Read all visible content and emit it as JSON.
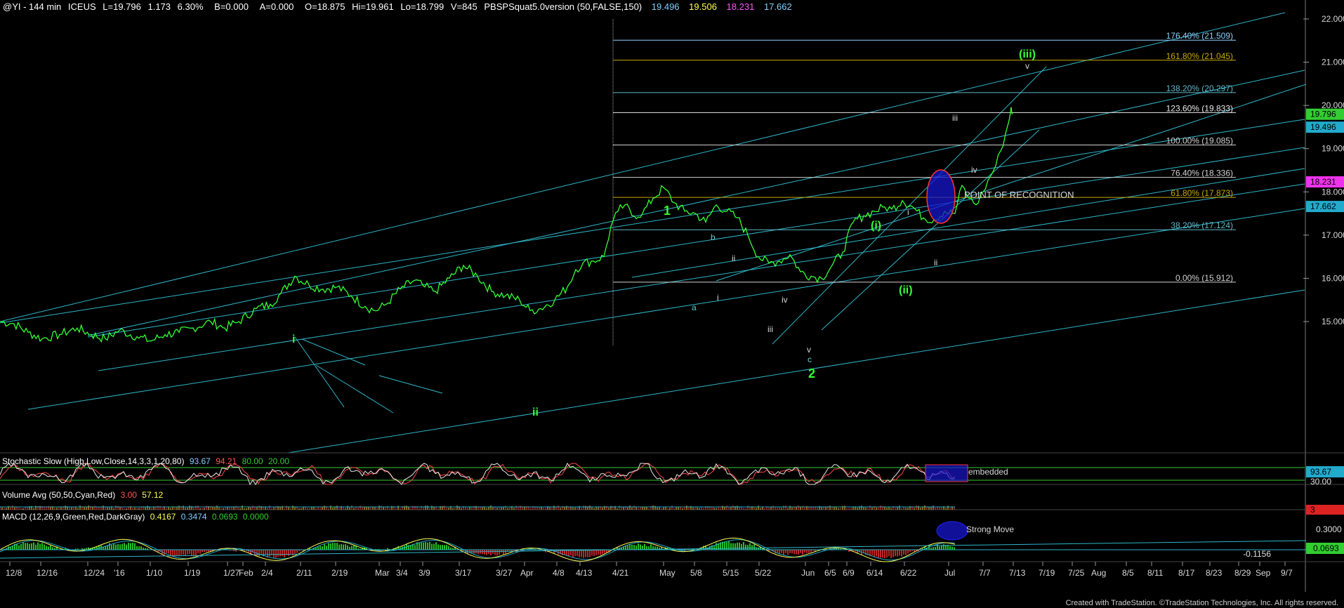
{
  "header": {
    "symbol": "@YI - 144 min",
    "exchange": "ICEUS",
    "last": "L=19.796",
    "change": "1.173",
    "pct": "6.30%",
    "bid": "B=0.000",
    "ask": "A=0.000",
    "open": "O=18.875",
    "high": "Hi=19.961",
    "low": "Lo=18.799",
    "volume": "V=845",
    "indicator": "PBSPSquat5.0version (50,FALSE,150)",
    "ind_values": [
      "19.496",
      "19.506",
      "18.231",
      "17.662"
    ],
    "ind_colors": [
      "#7fd0ff",
      "#ffff55",
      "#ff55ff",
      "#7fd0ff"
    ]
  },
  "chart_data": {
    "type": "line",
    "title": "@YI - 144 min",
    "y_ticks": [
      "22.000",
      "21.000",
      "20.000",
      "19.000",
      "18.000",
      "17.000",
      "16.000",
      "15.000"
    ],
    "ylim": [
      14.0,
      22.3
    ],
    "x_ticks": [
      "12/8",
      "12/16",
      "12/24",
      "'16",
      "1/10",
      "1/19",
      "1/27",
      "Feb",
      "2/4",
      "2/11",
      "2/19",
      "Mar",
      "3/4",
      "3/9",
      "3/17",
      "3/27",
      "Apr",
      "4/8",
      "4/13",
      "4/21",
      "May",
      "5/8",
      "5/15",
      "5/22",
      "Jun",
      "6/5",
      "6/9",
      "6/14",
      "6/22",
      "Jul",
      "7/7",
      "7/13",
      "7/19",
      "7/25",
      "Aug",
      "8/5",
      "8/11",
      "8/17",
      "8/23",
      "8/29",
      "Sep",
      "9/7"
    ],
    "price_path": [
      [
        0,
        15.0
      ],
      [
        20,
        14.95
      ],
      [
        40,
        14.75
      ],
      [
        60,
        14.6
      ],
      [
        85,
        14.7
      ],
      [
        110,
        14.85
      ],
      [
        130,
        14.7
      ],
      [
        150,
        14.6
      ],
      [
        170,
        14.8
      ],
      [
        195,
        14.65
      ],
      [
        215,
        14.55
      ],
      [
        235,
        14.7
      ],
      [
        255,
        14.75
      ],
      [
        275,
        14.85
      ],
      [
        300,
        15.0
      ],
      [
        320,
        14.85
      ],
      [
        340,
        15.0
      ],
      [
        365,
        15.3
      ],
      [
        385,
        15.4
      ],
      [
        400,
        15.65
      ],
      [
        420,
        16.05
      ],
      [
        440,
        15.85
      ],
      [
        460,
        15.75
      ],
      [
        480,
        15.8
      ],
      [
        500,
        15.6
      ],
      [
        520,
        15.35
      ],
      [
        535,
        15.25
      ],
      [
        550,
        15.4
      ],
      [
        570,
        15.75
      ],
      [
        590,
        15.95
      ],
      [
        605,
        15.8
      ],
      [
        620,
        15.7
      ],
      [
        640,
        16.0
      ],
      [
        660,
        16.3
      ],
      [
        680,
        16.05
      ],
      [
        700,
        15.7
      ],
      [
        720,
        15.6
      ],
      [
        740,
        15.5
      ],
      [
        755,
        15.25
      ],
      [
        770,
        15.3
      ],
      [
        790,
        15.5
      ],
      [
        808,
        15.8
      ],
      [
        820,
        16.2
      ],
      [
        830,
        16.35
      ],
      [
        845,
        16.4
      ],
      [
        860,
        16.5
      ],
      [
        870,
        17.2
      ],
      [
        880,
        17.55
      ],
      [
        890,
        17.7
      ],
      [
        900,
        17.45
      ],
      [
        915,
        17.5
      ],
      [
        930,
        17.85
      ],
      [
        945,
        18.1
      ],
      [
        960,
        17.75
      ],
      [
        975,
        17.55
      ],
      [
        990,
        17.5
      ],
      [
        1005,
        17.3
      ],
      [
        1020,
        17.7
      ],
      [
        1035,
        17.55
      ],
      [
        1050,
        17.4
      ],
      [
        1065,
        17.0
      ],
      [
        1080,
        16.5
      ],
      [
        1095,
        16.35
      ],
      [
        1110,
        16.4
      ],
      [
        1125,
        16.55
      ],
      [
        1140,
        16.15
      ],
      [
        1155,
        16.05
      ],
      [
        1170,
        16.0
      ],
      [
        1185,
        16.3
      ],
      [
        1200,
        16.6
      ],
      [
        1215,
        17.3
      ],
      [
        1230,
        17.45
      ],
      [
        1245,
        17.55
      ],
      [
        1260,
        17.65
      ],
      [
        1270,
        17.6
      ],
      [
        1285,
        17.8
      ],
      [
        1300,
        17.65
      ],
      [
        1315,
        17.4
      ],
      [
        1330,
        17.35
      ],
      [
        1345,
        17.55
      ],
      [
        1360,
        17.5
      ],
      [
        1370,
        18.15
      ],
      [
        1380,
        17.85
      ],
      [
        1390,
        17.7
      ],
      [
        1400,
        18.0
      ],
      [
        1410,
        18.35
      ],
      [
        1418,
        18.6
      ],
      [
        1425,
        18.95
      ],
      [
        1432,
        19.35
      ],
      [
        1437,
        19.65
      ],
      [
        1440,
        19.96
      ],
      [
        1442,
        19.8
      ]
    ]
  },
  "fib_levels": [
    {
      "label": "176.40% (21.509)",
      "value": 21.509,
      "color": "#8fd0ff"
    },
    {
      "label": "161.80% (21.045)",
      "value": 21.045,
      "color": "#c8a800"
    },
    {
      "label": "138.20% (20.297)",
      "value": 20.297,
      "color": "#5fb8c8"
    },
    {
      "label": "123.60% (19.833)",
      "value": 19.833,
      "color": "#e8e8e8"
    },
    {
      "label": "100.00% (19.085)",
      "value": 19.085,
      "color": "#d0d0d0"
    },
    {
      "label": "76.40% (18.336)",
      "value": 18.336,
      "color": "#d0d0d0"
    },
    {
      "label": "61.80% (17.873)",
      "value": 17.873,
      "color": "#c8a800"
    },
    {
      "label": "38.20% (17.124)",
      "value": 17.124,
      "color": "#5fb8c8"
    },
    {
      "label": "0.00% (15.912)",
      "value": 15.912,
      "color": "#d0d0d0"
    }
  ],
  "price_badges": [
    {
      "text": "19.796",
      "value": 19.796,
      "bg": "#33cc33",
      "fg": "#000000"
    },
    {
      "text": "19.496",
      "value": 19.496,
      "bg": "#22aacc",
      "fg": "#000000"
    },
    {
      "text": "18.231",
      "value": 18.231,
      "bg": "#ee33ee",
      "fg": "#000000"
    },
    {
      "text": "17.662",
      "value": 17.662,
      "bg": "#22aacc",
      "fg": "#000000"
    }
  ],
  "wave_labels": {
    "w1": "1",
    "w2": "2",
    "wi": "i",
    "wii": "ii",
    "wa": "a",
    "wb": "b",
    "wc": "c",
    "wi_small": "i",
    "wii_small": "ii",
    "wiii_small": "iii",
    "wiv_small": "iv",
    "wv_small": "v",
    "w_i_paren": "(i)",
    "w_ii_paren": "(ii)",
    "w_iii_paren": "(iii)",
    "w_v_top": "v",
    "w_iii_top": "iii",
    "w_iv_top": "iv",
    "w_i_top": "i",
    "w_ii_top": "ii"
  },
  "annotations": {
    "point": "POINT OF RECOGNITION",
    "embedded": "embedded",
    "strong": "Strong Move"
  },
  "stochastic": {
    "title": "Stochastic Slow (High,Low,Close,14,3,3,1,20,80)",
    "v1": "93.67",
    "v2": "94.21",
    "v3": "80.00",
    "v4": "20.00",
    "badge1": "93.67",
    "badge2": "30.00"
  },
  "volume": {
    "title": "Volume Avg (50,50,Cyan,Red)",
    "v1": "3.00",
    "v2": "57.12",
    "badge": "3"
  },
  "macd": {
    "title": "MACD (12,26,9,Green,Red,DarkGray)",
    "v1": "0.4167",
    "v2": "0.3474",
    "v3": "0.0693",
    "v4": "0.0000",
    "badge1": "0.3000",
    "badge2": "0.0693",
    "neg": "-0.1156"
  },
  "footer": {
    "text": "Created with TradeStation. ©TradeStation Technologies, Inc. All rights reserved."
  }
}
